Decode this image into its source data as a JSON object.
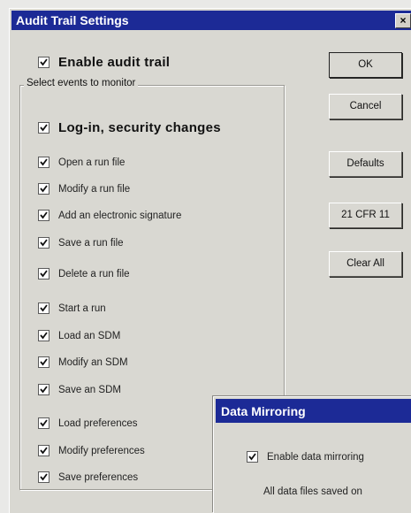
{
  "dialog": {
    "title": "Audit Trail Settings",
    "close_glyph": "×",
    "enable_audit_trail": {
      "label": "Enable audit trail",
      "checked": true
    },
    "group_label": "Select events to monitor",
    "events": [
      {
        "label": "Log-in, security changes",
        "checked": true
      },
      {
        "label": "Open a run file",
        "checked": true
      },
      {
        "label": "Modify a run file",
        "checked": true
      },
      {
        "label": "Add an electronic signature",
        "checked": true
      },
      {
        "label": "Save a run file",
        "checked": true
      },
      {
        "label": "Delete a run file",
        "checked": true
      },
      {
        "label": "Start a run",
        "checked": true
      },
      {
        "label": "Load an SDM",
        "checked": true
      },
      {
        "label": "Modify an SDM",
        "checked": true
      },
      {
        "label": "Save an SDM",
        "checked": true
      },
      {
        "label": "Load preferences",
        "checked": true
      },
      {
        "label": "Modify preferences",
        "checked": true
      },
      {
        "label": "Save preferences",
        "checked": true
      }
    ],
    "buttons": {
      "ok": "OK",
      "cancel": "Cancel",
      "defaults": "Defaults",
      "cfr": "21 CFR 11",
      "clear_all": "Clear All"
    }
  },
  "data_mirroring": {
    "title": "Data Mirroring",
    "enable_label": "Enable data mirroring",
    "enable_checked": true,
    "text": "All data files saved on"
  },
  "colors": {
    "titlebar": "#1c2a96",
    "dialog_bg": "#d9d8d2"
  }
}
